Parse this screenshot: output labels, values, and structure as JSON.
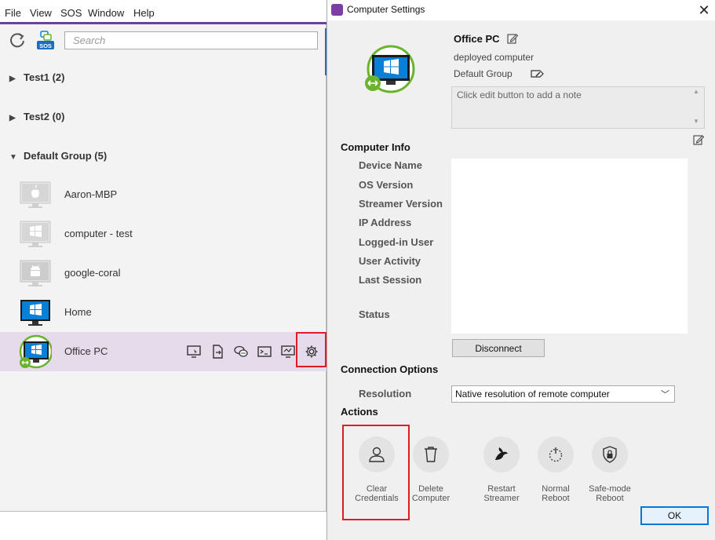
{
  "main_window": {
    "menu": [
      "File",
      "View",
      "SOS",
      "Window",
      "Help"
    ],
    "toolbar": {
      "refresh_icon": "refresh-icon",
      "sos_icon": "sos-icon",
      "sos_label": "SOS"
    },
    "search": {
      "placeholder": "Search",
      "value": ""
    },
    "groups": [
      {
        "label": "Test1 (2)",
        "expanded": false
      },
      {
        "label": "Test2 (0)",
        "expanded": false
      },
      {
        "label": "Default Group (5)",
        "expanded": true
      }
    ],
    "computers": [
      {
        "name": "Aaron-MBP",
        "os": "mac",
        "online": false
      },
      {
        "name": "computer - test",
        "os": "windows",
        "online": false
      },
      {
        "name": "google-coral",
        "os": "android",
        "online": false
      },
      {
        "name": "Home",
        "os": "windows",
        "online": true
      },
      {
        "name": "Office PC",
        "os": "windows",
        "online": true,
        "selected": true,
        "connected": true
      }
    ],
    "row_actions": [
      "remote-control-icon",
      "file-transfer-icon",
      "chat-icon",
      "terminal-icon",
      "monitor-icon",
      "gear-icon"
    ]
  },
  "dialog": {
    "title": "Computer Settings",
    "computer_name": "Office PC",
    "description": "deployed computer",
    "group": "Default Group",
    "note_placeholder": "Click edit button to add a note",
    "computer_info": {
      "heading": "Computer Info",
      "labels": [
        "Device Name",
        "OS Version",
        "Streamer Version",
        "IP Address",
        "Logged-in User",
        "User Activity",
        "Last Session",
        "Status"
      ]
    },
    "disconnect_label": "Disconnect",
    "connection_options": {
      "heading": "Connection Options",
      "resolution_label": "Resolution",
      "resolution_value": "Native resolution of remote computer"
    },
    "actions_heading": "Actions",
    "actions": [
      {
        "line1": "Clear",
        "line2": "Credentials",
        "icon": "user-icon"
      },
      {
        "line1": "Delete",
        "line2": "Computer",
        "icon": "trash-icon"
      },
      {
        "line1": "Restart",
        "line2": "Streamer",
        "icon": "streamer-icon"
      },
      {
        "line1": "Normal",
        "line2": "Reboot",
        "icon": "power-icon"
      },
      {
        "line1": "Safe-mode",
        "line2": "Reboot",
        "icon": "shield-lock-icon"
      }
    ],
    "ok_label": "OK"
  },
  "colors": {
    "accent_purple": "#6b3fa0",
    "selection": "#e6dbeb",
    "highlight_red": "#e01b24",
    "windows_blue": "#0a7fd6",
    "online_green": "#6ab42d"
  }
}
